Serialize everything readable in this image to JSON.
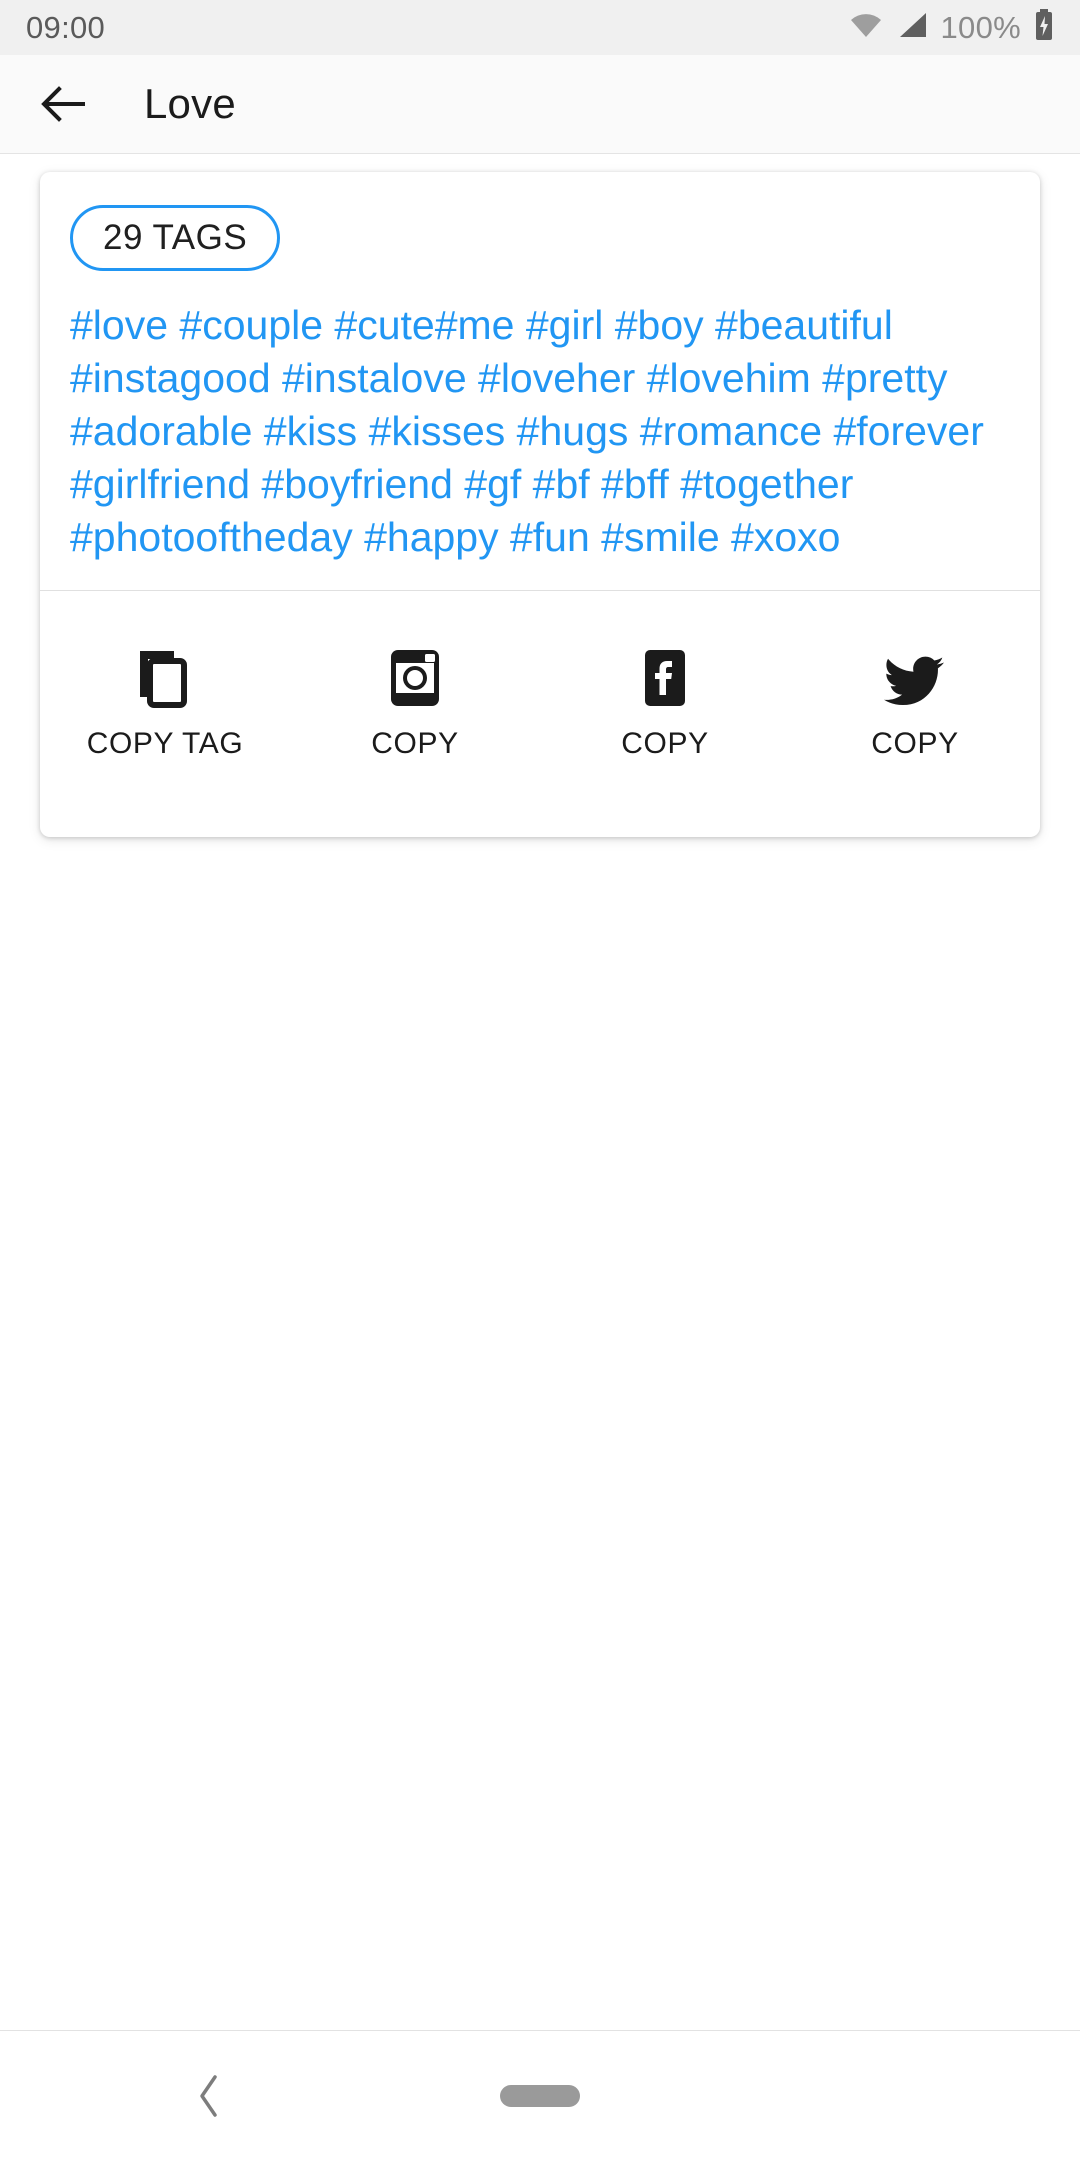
{
  "status_bar": {
    "time": "09:00",
    "battery_percent": "100%",
    "wifi_icon": "wifi-icon",
    "signal_icon": "cellular-signal-icon",
    "battery_icon": "battery-charging-icon",
    "background": "#f0f0f0"
  },
  "app_bar": {
    "back_icon": "back-arrow-icon",
    "title": "Love",
    "background": "#fafafa"
  },
  "card": {
    "chip_label": "29 TAGS",
    "chip_border_color": "#2196f3",
    "tag_color": "#2196f3",
    "tags_text": "#love #couple #cute#me #girl #boy #beautiful #instagood #instalove #loveher #lovehim #pretty  #adorable #kiss #kisses #hugs #romance #forever #girlfriend #boyfriend #gf #bf #bff #together #photooftheday #happy #fun #smile #xoxo",
    "tag_count": 29,
    "tags": [
      "#love",
      "#couple",
      "#cute",
      "#me",
      "#girl",
      "#boy",
      "#beautiful",
      "#instagood",
      "#instalove",
      "#loveher",
      "#lovehim",
      "#pretty",
      "#adorable",
      "#kiss",
      "#kisses",
      "#hugs",
      "#romance",
      "#forever",
      "#girlfriend",
      "#boyfriend",
      "#gf",
      "#bf",
      "#bff",
      "#together",
      "#photooftheday",
      "#happy",
      "#fun",
      "#smile",
      "#xoxo"
    ],
    "actions": [
      {
        "icon": "copy-icon",
        "label": "COPY TAG"
      },
      {
        "icon": "instagram-icon",
        "label": "COPY"
      },
      {
        "icon": "facebook-icon",
        "label": "COPY"
      },
      {
        "icon": "twitter-icon",
        "label": "COPY"
      }
    ]
  },
  "nav_bar": {
    "back_icon": "nav-back-chevron-icon",
    "home_indicator": "home-pill-indicator"
  }
}
